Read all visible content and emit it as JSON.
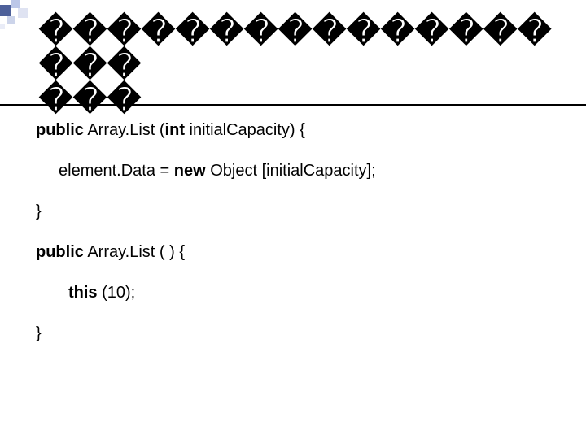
{
  "title": {
    "row1": "������������������",
    "row2": "���"
  },
  "code": {
    "l1_kw": "public",
    "l1_mid": " Array.List (",
    "l1_kw2": "int",
    "l1_end": " initialCapacity) {",
    "l2_pre": "element.Data = ",
    "l2_kw": "new",
    "l2_end": " Object [initialCapacity];",
    "l3": "}",
    "l4_kw": "public",
    "l4_end": " Array.List ( ) {",
    "l5_kw": "this",
    "l5_end": " (10);",
    "l6": "}"
  }
}
